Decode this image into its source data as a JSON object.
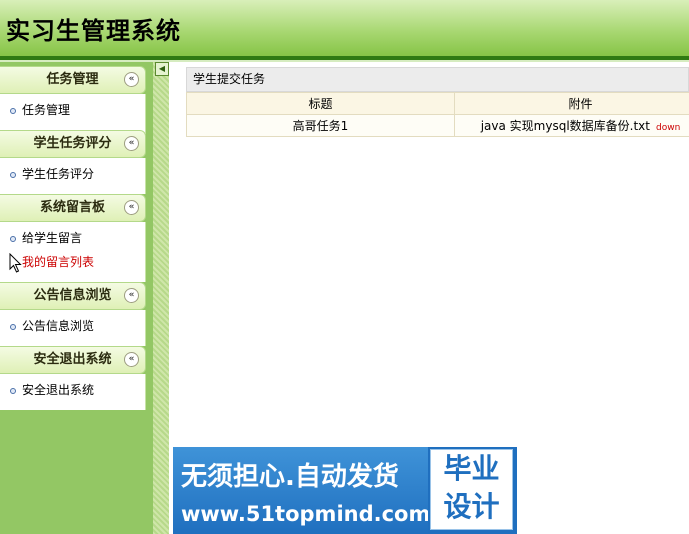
{
  "app": {
    "title": "实习生管理系统"
  },
  "sidebar": {
    "groups": [
      {
        "title": "任务管理",
        "items": [
          {
            "label": "任务管理"
          }
        ]
      },
      {
        "title": "学生任务评分",
        "items": [
          {
            "label": "学生任务评分"
          }
        ]
      },
      {
        "title": "系统留言板",
        "items": [
          {
            "label": "给学生留言"
          },
          {
            "label": "我的留言列表"
          }
        ]
      },
      {
        "title": "公告信息浏览",
        "items": [
          {
            "label": "公告信息浏览"
          }
        ]
      },
      {
        "title": "安全退出系统",
        "items": [
          {
            "label": "安全退出系统"
          }
        ]
      }
    ],
    "collapse_glyph": "«",
    "splitter_glyph": "◀"
  },
  "main": {
    "panel_title": "学生提交任务",
    "table": {
      "columns": [
        "标题",
        "附件"
      ],
      "rows": [
        {
          "title": "高哥任务1",
          "attachment": "java 实现mysql数据库备份.txt",
          "action": "down"
        }
      ]
    }
  },
  "banner": {
    "line1": "无须担心.自动发货",
    "line2": "www.51topmind.com",
    "box_line1": "毕业",
    "box_line2": "设计"
  },
  "colors": {
    "header_green": "#86c446",
    "header_border": "#2f7a12",
    "sidebar_bg": "#93c764",
    "active_link": "#cc0000",
    "banner_blue": "#1f6fbf"
  }
}
